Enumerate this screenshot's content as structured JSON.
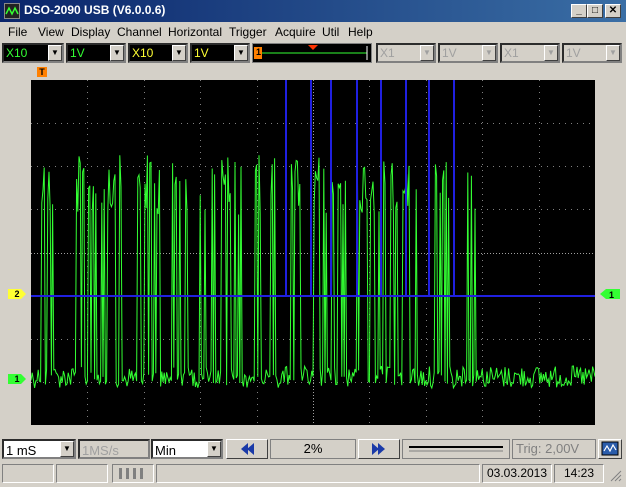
{
  "window": {
    "title": "DSO-2090 USB (V6.0.0.6)",
    "minimize": "_",
    "maximize": "□",
    "close": "✕"
  },
  "menu": [
    "File",
    "View",
    "Display",
    "Channel",
    "Horizontal",
    "Trigger",
    "Acquire",
    "Util",
    "Help"
  ],
  "toolbar": {
    "ch1_probe": "X10",
    "ch1_volts": "1V",
    "ch2_probe": "X10",
    "ch2_volts": "1V",
    "trigger_slider_label": "1",
    "ch3_probe": "X1",
    "ch3_volts": "1V",
    "ch4_probe": "X1",
    "ch4_volts": "1V"
  },
  "markers": {
    "trigger_top": "T",
    "ch2": "2",
    "ch1": "1"
  },
  "bottom": {
    "timebase": "1 mS",
    "samplerate": "1MS/s",
    "mode": "Min",
    "position": "2%",
    "trigger_level": "Trig: 2,00V"
  },
  "status": {
    "date": "03.03.2013",
    "time": "14:23"
  },
  "colors": {
    "ch1": "#33ff33",
    "ch2": "#2020e0",
    "grid": "#a0a0a0",
    "screen_bg": "#000000",
    "ch1_label": "#33ff33",
    "ch2_label": "#ffff33"
  }
}
